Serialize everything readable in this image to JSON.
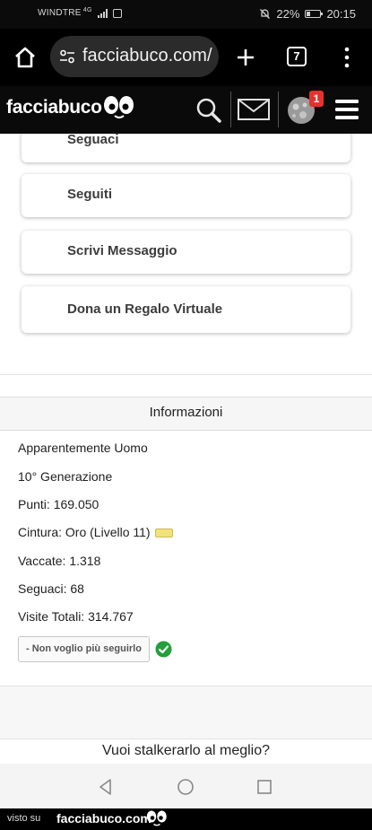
{
  "status_bar": {
    "carrier": "WINDTRE",
    "network": "4G",
    "battery": "22%",
    "time": "20:15"
  },
  "browser": {
    "url": "facciabuco.com/",
    "tab_count": "7"
  },
  "site": {
    "logo": "facciabuco",
    "notification_count": "1"
  },
  "profile_menu": {
    "items": [
      {
        "label": "Seguaci"
      },
      {
        "label": "Seguiti"
      },
      {
        "label": "Scrivi Messaggio"
      },
      {
        "label": "Dona un Regalo Virtuale"
      }
    ]
  },
  "info": {
    "heading": "Informazioni",
    "lines": [
      "Apparentemente Uomo",
      "10° Generazione",
      "Punti: 169.050",
      "Cintura: Oro (Livello 11)",
      "Vaccate: 1.318",
      "Seguaci: 68",
      "Visite Totali: 314.767"
    ],
    "unfollow_button": "- Non voglio più seguirlo"
  },
  "stalker_prompt": "Vuoi stalkerarlo al meglio?",
  "watermark": {
    "prefix": "visto su",
    "brand": "facciabuco.com"
  },
  "colors": {
    "badge": "#e5322d",
    "check": "#22a03a",
    "belt": "#f2e27a"
  }
}
